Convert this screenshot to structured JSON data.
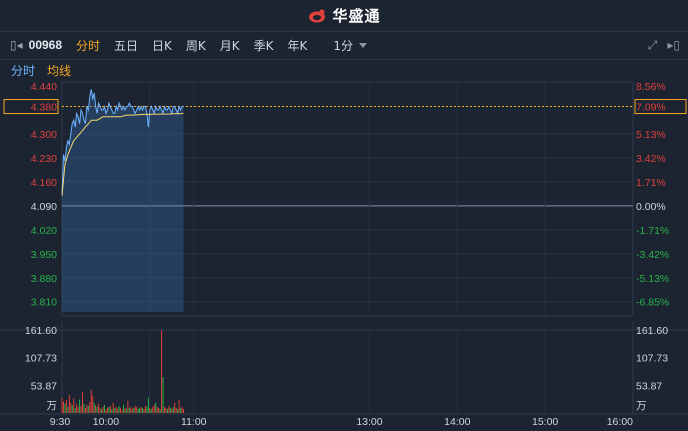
{
  "brand": {
    "name": "华盛通"
  },
  "toolbar": {
    "code": "00968",
    "periods": [
      "分时",
      "五日",
      "日K",
      "周K",
      "月K",
      "季K",
      "年K"
    ],
    "active_period": "分时",
    "minute_select": "1分"
  },
  "legend": {
    "line1": "分时",
    "line2": "均线"
  },
  "colors": {
    "up": "#e0413c",
    "down": "#28b24a",
    "price_line": "#6db3ff",
    "avg_line": "#f5d76e",
    "accent": "#f5a623",
    "neutral": "#cfd6e0"
  },
  "price_axis": {
    "left_ticks": [
      "4.440",
      "4.380",
      "4.300",
      "4.230",
      "4.160",
      "4.090",
      "4.020",
      "3.950",
      "3.880",
      "3.810"
    ],
    "right_ticks": [
      "8.56%",
      "7.09%",
      "5.13%",
      "3.42%",
      "1.71%",
      "0.00%",
      "-1.71%",
      "-3.42%",
      "-5.13%",
      "-6.85%"
    ],
    "ylim": [
      3.78,
      4.44
    ],
    "prev_close": 4.09,
    "current_marker": 4.38
  },
  "volume_axis": {
    "left_ticks": [
      "161.60",
      "107.73",
      "53.87",
      "万"
    ],
    "right_ticks": [
      "161.60",
      "107.73",
      "53.87",
      "万"
    ],
    "max": 161.6
  },
  "time_axis": {
    "labels": [
      "9:30",
      "10:00",
      "11:00",
      "13:00",
      "14:00",
      "15:00",
      "16:00"
    ]
  },
  "chart_data": {
    "type": "line",
    "x_unit": "minutes since 9:30",
    "series": [
      {
        "name": "分时",
        "x": [
          0,
          1,
          2,
          3,
          4,
          5,
          6,
          7,
          8,
          9,
          10,
          11,
          12,
          13,
          14,
          15,
          16,
          17,
          18,
          19,
          20,
          21,
          22,
          23,
          24,
          25,
          26,
          27,
          28,
          29,
          30,
          31,
          32,
          33,
          34,
          35,
          36,
          37,
          38,
          39,
          40,
          41,
          42,
          43,
          44,
          45,
          46,
          47,
          48,
          49,
          50,
          51,
          52,
          53,
          54,
          55,
          56,
          57,
          58,
          59,
          60,
          61,
          62,
          63,
          64,
          65,
          66,
          67,
          68,
          69,
          70,
          71,
          72,
          73,
          74,
          75,
          76,
          77,
          78,
          79,
          80,
          81,
          82,
          83
        ],
        "values": [
          4.12,
          4.24,
          4.22,
          4.26,
          4.28,
          4.27,
          4.3,
          4.33,
          4.34,
          4.32,
          4.36,
          4.35,
          4.33,
          4.37,
          4.36,
          4.34,
          4.33,
          4.38,
          4.37,
          4.41,
          4.43,
          4.4,
          4.42,
          4.38,
          4.36,
          4.39,
          4.38,
          4.37,
          4.37,
          4.38,
          4.36,
          4.37,
          4.39,
          4.38,
          4.37,
          4.36,
          4.36,
          4.38,
          4.37,
          4.39,
          4.38,
          4.37,
          4.38,
          4.37,
          4.38,
          4.38,
          4.39,
          4.38,
          4.38,
          4.37,
          4.36,
          4.37,
          4.38,
          4.37,
          4.38,
          4.37,
          4.38,
          4.38,
          4.36,
          4.32,
          4.37,
          4.38,
          4.37,
          4.36,
          4.38,
          4.37,
          4.37,
          4.38,
          4.37,
          4.36,
          4.38,
          4.37,
          4.37,
          4.38,
          4.37,
          4.36,
          4.38,
          4.38,
          4.37,
          4.36,
          4.38,
          4.37,
          4.38,
          4.38
        ]
      },
      {
        "name": "均线",
        "x": [
          0,
          2,
          4,
          6,
          8,
          10,
          12,
          14,
          16,
          18,
          20,
          24,
          28,
          32,
          36,
          40,
          44,
          48,
          52,
          56,
          60,
          64,
          68,
          72,
          76,
          80,
          83
        ],
        "values": [
          4.12,
          4.21,
          4.24,
          4.26,
          4.28,
          4.29,
          4.3,
          4.31,
          4.32,
          4.33,
          4.34,
          4.34,
          4.35,
          4.35,
          4.35,
          4.35,
          4.355,
          4.355,
          4.356,
          4.357,
          4.357,
          4.358,
          4.358,
          4.358,
          4.359,
          4.359,
          4.36
        ]
      }
    ],
    "volume": {
      "x": [
        0,
        1,
        2,
        3,
        4,
        5,
        6,
        7,
        8,
        9,
        10,
        11,
        12,
        13,
        14,
        15,
        16,
        17,
        18,
        19,
        20,
        21,
        22,
        23,
        24,
        25,
        26,
        27,
        28,
        29,
        30,
        31,
        32,
        33,
        34,
        35,
        36,
        37,
        38,
        39,
        40,
        41,
        42,
        43,
        44,
        45,
        46,
        47,
        48,
        49,
        50,
        51,
        52,
        53,
        54,
        55,
        56,
        57,
        58,
        59,
        60,
        61,
        62,
        63,
        64,
        65,
        66,
        67,
        68,
        69,
        70,
        71,
        72,
        73,
        74,
        75,
        76,
        77,
        78,
        79,
        80,
        81,
        82,
        83
      ],
      "values": [
        30,
        22,
        18,
        25,
        12,
        35,
        20,
        15,
        28,
        10,
        18,
        12,
        26,
        14,
        40,
        18,
        10,
        16,
        14,
        22,
        45,
        34,
        20,
        15,
        12,
        18,
        10,
        8,
        12,
        16,
        6,
        10,
        12,
        14,
        8,
        20,
        10,
        12,
        8,
        14,
        10,
        6,
        16,
        10,
        8,
        24,
        10,
        12,
        8,
        10,
        14,
        12,
        8,
        10,
        12,
        10,
        8,
        14,
        12,
        30,
        10,
        8,
        12,
        16,
        20,
        12,
        10,
        8,
        161,
        70,
        12,
        10,
        8,
        14,
        10,
        8,
        12,
        20,
        10,
        8,
        26,
        10,
        12,
        8
      ],
      "direction": [
        "u",
        "u",
        "d",
        "u",
        "d",
        "u",
        "u",
        "d",
        "u",
        "d",
        "u",
        "u",
        "d",
        "u",
        "u",
        "d",
        "u",
        "u",
        "d",
        "u",
        "u",
        "u",
        "d",
        "u",
        "d",
        "u",
        "u",
        "d",
        "u",
        "d",
        "u",
        "u",
        "d",
        "u",
        "d",
        "u",
        "d",
        "u",
        "u",
        "d",
        "u",
        "u",
        "d",
        "u",
        "d",
        "u",
        "d",
        "u",
        "u",
        "d",
        "u",
        "u",
        "d",
        "d",
        "u",
        "d",
        "u",
        "u",
        "d",
        "d",
        "u",
        "d",
        "u",
        "u",
        "d",
        "u",
        "u",
        "d",
        "u",
        "d",
        "u",
        "u",
        "d",
        "u",
        "d",
        "u",
        "d",
        "u",
        "u",
        "d",
        "u",
        "d",
        "u",
        "u"
      ]
    }
  }
}
